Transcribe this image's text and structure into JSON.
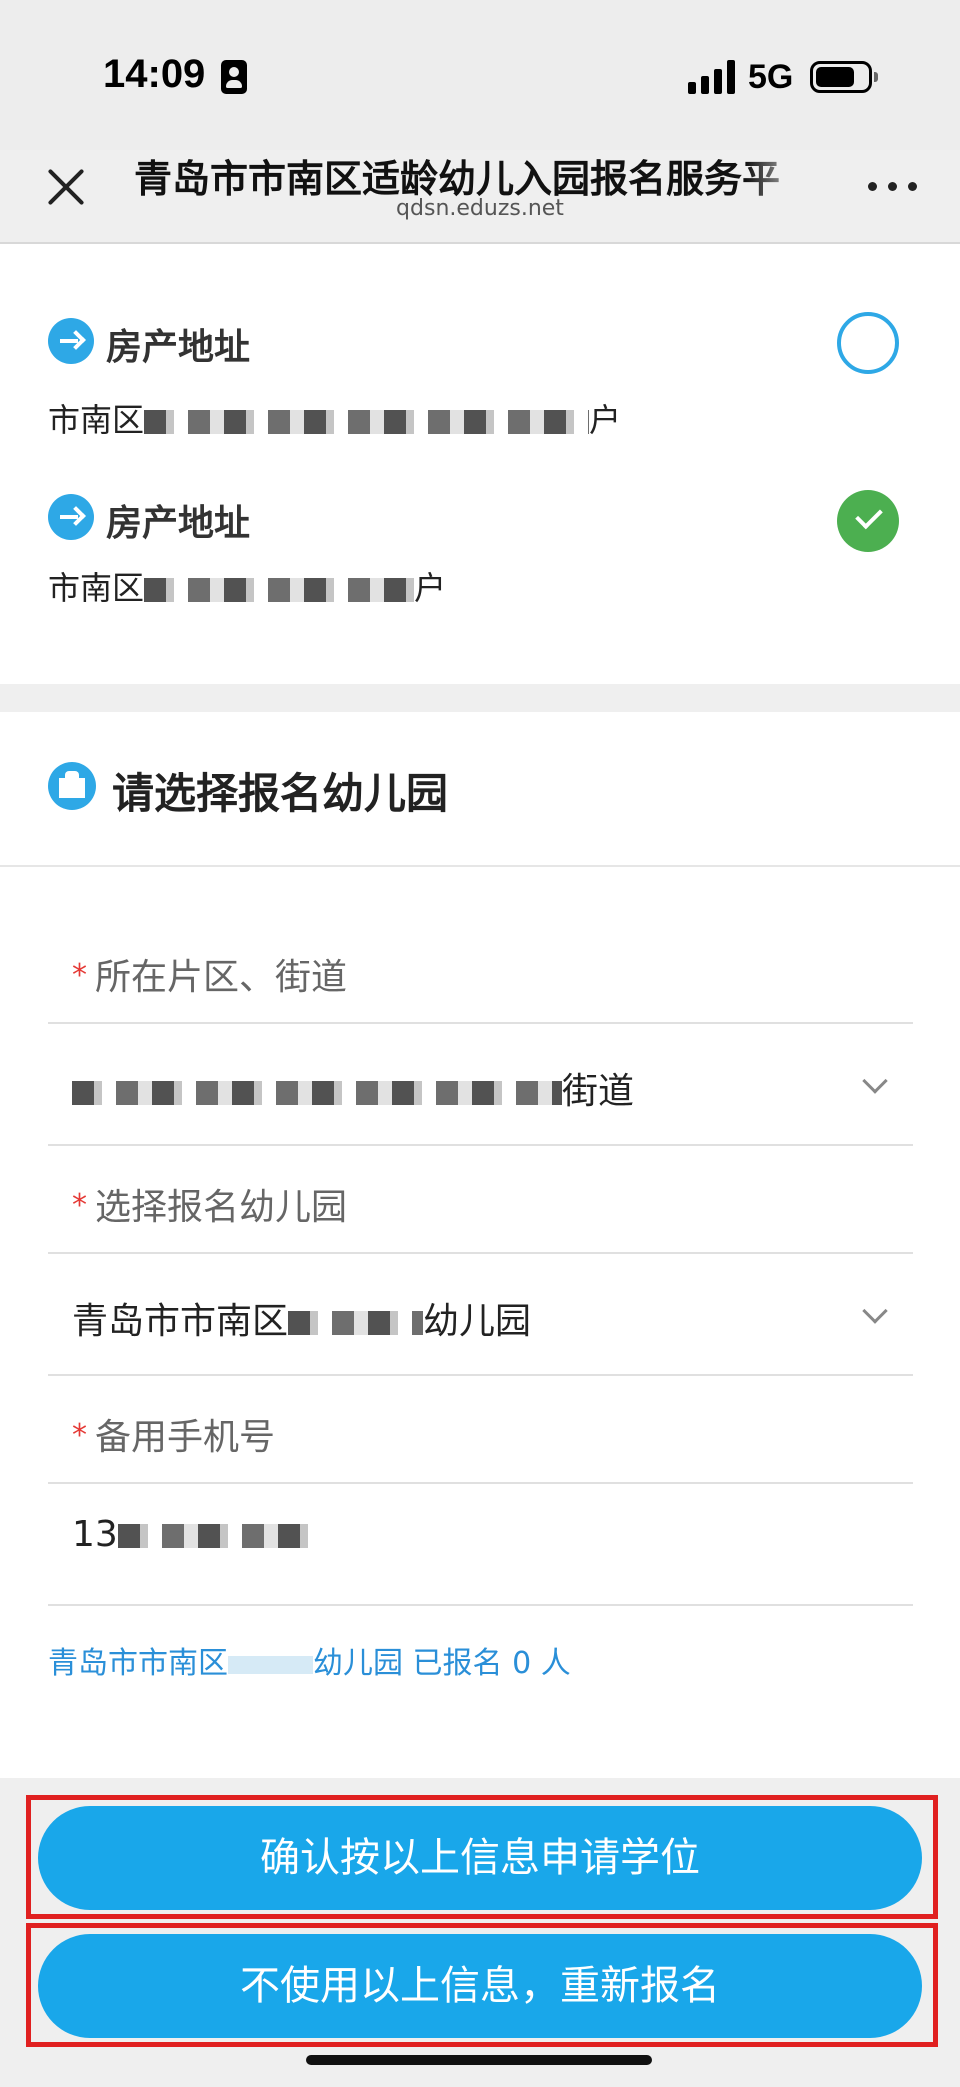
{
  "status_bar": {
    "time": "14:09",
    "network": "5G"
  },
  "nav": {
    "title": "青岛市市南区适龄幼儿入园报名服务平",
    "url": "qdsn.eduzs.net"
  },
  "addresses": [
    {
      "label": "房产地址",
      "prefix": "市南区",
      "suffix": "户",
      "selected": false
    },
    {
      "label": "房产地址",
      "prefix": "市南区",
      "suffix": "户",
      "selected": true
    }
  ],
  "kindergarten": {
    "section_title": "请选择报名幼儿园",
    "fields": {
      "district": {
        "label": "所在片区、街道",
        "value_suffix": "街道"
      },
      "school": {
        "label": "选择报名幼儿园",
        "value_prefix": "青岛市市南区",
        "value_suffix": "幼儿园"
      },
      "phone": {
        "label": "备用手机号",
        "value_prefix": "13"
      }
    },
    "required_mark": "*",
    "note": {
      "prefix": "青岛市市南区",
      "suffix": "幼儿园 已报名 0 人"
    }
  },
  "buttons": {
    "confirm": "确认按以上信息申请学位",
    "reregister": "不使用以上信息，重新报名"
  },
  "colors": {
    "accent": "#19a7ea",
    "selected": "#4caf50",
    "required": "#e53935",
    "highlight_frame": "#e02020",
    "link": "#2a8fd8"
  }
}
